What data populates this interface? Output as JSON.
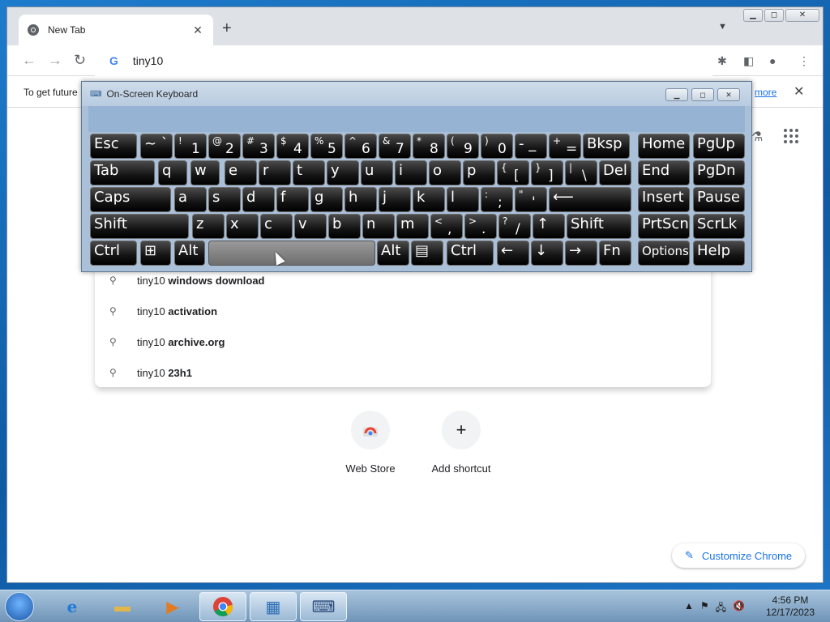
{
  "browser": {
    "tab_title": "New Tab",
    "new_tab_icon": "+",
    "tab_search_icon": "chevron-down-icon",
    "omnibox_value": "tiny10",
    "infobar_text": "To get future",
    "infobar_link": "more"
  },
  "suggestions": [
    {
      "prefix": "tiny10",
      "suffix": "windows download"
    },
    {
      "prefix": "tiny10",
      "suffix": "activation"
    },
    {
      "prefix": "tiny10",
      "suffix": "archive.org"
    },
    {
      "prefix": "tiny10",
      "suffix": "23h1"
    }
  ],
  "shortcuts": [
    {
      "label": "Web Store",
      "icon": "web-store-icon"
    },
    {
      "label": "Add shortcut",
      "icon": "+"
    }
  ],
  "customize_label": "Customize Chrome",
  "osk": {
    "title": "On-Screen Keyboard",
    "keys": [
      {
        "label": "Esc"
      },
      {
        "label": "~ `"
      },
      {
        "shift": "!",
        "main": "1"
      },
      {
        "shift": "@",
        "main": "2"
      },
      {
        "shift": "#",
        "main": "3"
      },
      {
        "shift": "$",
        "main": "4"
      },
      {
        "shift": "%",
        "main": "5"
      },
      {
        "shift": "^",
        "main": "6"
      },
      {
        "shift": "&",
        "main": "7"
      },
      {
        "shift": "*",
        "main": "8"
      },
      {
        "shift": "(",
        "main": "9"
      },
      {
        "shift": ")",
        "main": "0"
      },
      {
        "label": "- _"
      },
      {
        "shift": "+",
        "main": "="
      },
      {
        "label": "Bksp"
      },
      {
        "label": "Home"
      },
      {
        "label": "PgUp"
      },
      {
        "label": "Tab"
      },
      {
        "label": "q"
      },
      {
        "label": "w"
      },
      {
        "label": "e"
      },
      {
        "label": "r"
      },
      {
        "label": "t"
      },
      {
        "label": "y"
      },
      {
        "label": "u"
      },
      {
        "label": "i"
      },
      {
        "label": "o"
      },
      {
        "label": "p"
      },
      {
        "shift": "{",
        "main": "["
      },
      {
        "shift": "}",
        "main": "]"
      },
      {
        "shift": "|",
        "main": "\\"
      },
      {
        "label": "Del"
      },
      {
        "label": "End"
      },
      {
        "label": "PgDn"
      },
      {
        "label": "Caps"
      },
      {
        "label": "a"
      },
      {
        "label": "s"
      },
      {
        "label": "d"
      },
      {
        "label": "f"
      },
      {
        "label": "g"
      },
      {
        "label": "h"
      },
      {
        "label": "j"
      },
      {
        "label": "k"
      },
      {
        "label": "l"
      },
      {
        "shift": ":",
        "main": ";"
      },
      {
        "shift": "\"",
        "main": "'"
      },
      {
        "label": "⟵"
      },
      {
        "label": "Insert"
      },
      {
        "label": "Pause"
      },
      {
        "label": "Shift"
      },
      {
        "label": "z"
      },
      {
        "label": "x"
      },
      {
        "label": "c"
      },
      {
        "label": "v"
      },
      {
        "label": "b"
      },
      {
        "label": "n"
      },
      {
        "label": "m"
      },
      {
        "shift": "<",
        "main": ","
      },
      {
        "shift": ">",
        "main": "."
      },
      {
        "shift": "?",
        "main": "/"
      },
      {
        "label": "↑"
      },
      {
        "label": "Shift"
      },
      {
        "label": "PrtScn"
      },
      {
        "label": "ScrLk"
      },
      {
        "label": "Ctrl"
      },
      {
        "label": "⊞"
      },
      {
        "label": "Alt"
      },
      {
        "label": ""
      },
      {
        "label": "Alt"
      },
      {
        "label": "▤"
      },
      {
        "label": "Ctrl"
      },
      {
        "label": "←"
      },
      {
        "label": "↓"
      },
      {
        "label": "→"
      },
      {
        "label": "Fn"
      },
      {
        "label": "Options"
      },
      {
        "label": "Help"
      }
    ]
  },
  "taskbar": {
    "time": "4:56 PM",
    "date": "12/17/2023"
  }
}
